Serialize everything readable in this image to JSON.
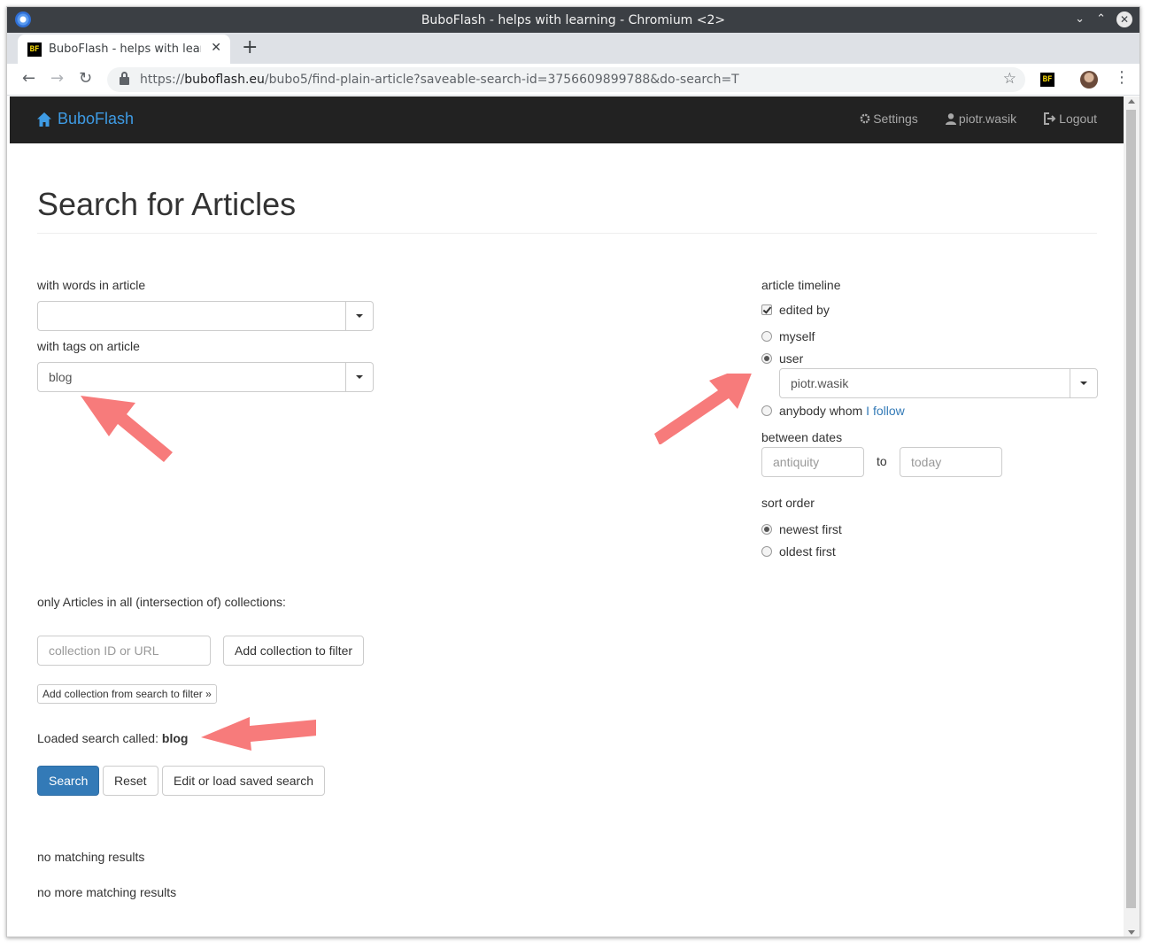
{
  "window": {
    "title": "BuboFlash - helps with learning - Chromium <2>"
  },
  "tab": {
    "favicon_text": "BF",
    "title": "BuboFlash - helps with learning"
  },
  "address": {
    "scheme": "https://",
    "host": "buboflash.eu",
    "path": "/bubo5/find-plain-article?saveable-search-id=3756609899788&do-search=T"
  },
  "extension": {
    "label": "BF"
  },
  "navbar": {
    "brand": "BuboFlash",
    "settings": "Settings",
    "user": "piotr.wasik",
    "logout": "Logout"
  },
  "page": {
    "title": "Search for Articles",
    "words_label": "with words in article",
    "words_value": "",
    "tags_label": "with tags on article",
    "tags_value": "blog",
    "timeline_label": "article timeline",
    "edited_by": "edited by",
    "myself": "myself",
    "user": "user",
    "user_value": "piotr.wasik",
    "anybody_whom": "anybody whom",
    "i_follow": "I follow",
    "between_dates": "between dates",
    "from_placeholder": "antiquity",
    "to": "to",
    "to_placeholder": "today",
    "sort_order": "sort order",
    "newest_first": "newest first",
    "oldest_first": "oldest first",
    "collections_label": "only Articles in all (intersection of) collections:",
    "collection_placeholder": "collection ID or URL",
    "add_collection": "Add collection to filter",
    "add_from_search": "Add collection from search to filter »",
    "loaded_search_prefix": "Loaded search called:",
    "loaded_search_name": "blog",
    "search_button": "Search",
    "reset_button": "Reset",
    "edit_load_button": "Edit or load saved search",
    "no_results": "no matching results",
    "no_more_results": "no more matching results"
  },
  "state": {
    "edited_by_checked": true,
    "selected_editor": "user",
    "selected_sort": "newest first"
  },
  "colors": {
    "navbar_bg": "#222222",
    "brand": "#3e9be4",
    "primary": "#337ab7",
    "annotation_arrow": "#f77b7b"
  }
}
